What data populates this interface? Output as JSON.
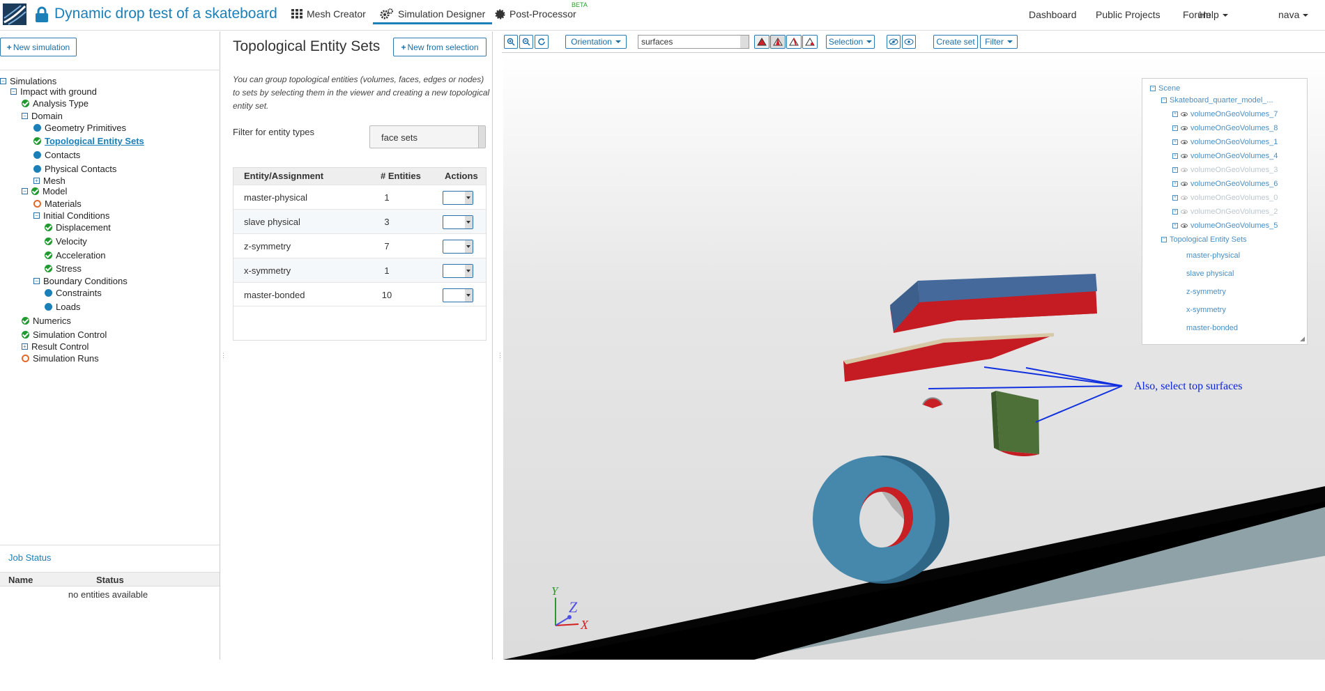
{
  "header": {
    "project_title": "Dynamic drop test of a skateboard",
    "nav": [
      {
        "label": "Mesh Creator",
        "icon": "grid-icon"
      },
      {
        "label": "Simulation Designer",
        "icon": "gears-icon",
        "active": true
      },
      {
        "label": "Post-Processor",
        "icon": "gear-icon"
      }
    ],
    "beta": "BETA",
    "right_nav": [
      "Dashboard",
      "Public Projects",
      "Forum",
      "Help"
    ],
    "user": "nava"
  },
  "left": {
    "new_simulation": "New simulation",
    "tree": {
      "simulations": "Simulations",
      "impact": "Impact with ground",
      "analysis_type": "Analysis Type",
      "domain": "Domain",
      "geometry_primitives": "Geometry Primitives",
      "topological_entity_sets": "Topological Entity Sets",
      "contacts": "Contacts",
      "physical_contacts": "Physical Contacts",
      "mesh": "Mesh",
      "model": "Model",
      "materials": "Materials",
      "initial_conditions": "Initial Conditions",
      "displacement": "Displacement",
      "velocity": "Velocity",
      "acceleration": "Acceleration",
      "stress": "Stress",
      "boundary_conditions": "Boundary Conditions",
      "constraints": "Constraints",
      "loads": "Loads",
      "numerics": "Numerics",
      "simulation_control": "Simulation Control",
      "result_control": "Result Control",
      "simulation_runs": "Simulation Runs"
    },
    "job_status": {
      "title": "Job Status",
      "col_name": "Name",
      "col_status": "Status",
      "empty": "no entities available"
    }
  },
  "middle": {
    "title": "Topological Entity Sets",
    "new_from_selection": "New from selection",
    "description": "You can group topological entities (volumes, faces, edges or nodes) to sets by selecting them in the viewer and creating a new topological entity set.",
    "filter_label": "Filter for entity types",
    "filter_value": "face sets",
    "table": {
      "headers": [
        "Entity/Assignment",
        "# Entities",
        "Actions"
      ],
      "rows": [
        {
          "name": "master-physical",
          "count": "1"
        },
        {
          "name": "slave physical",
          "count": "3"
        },
        {
          "name": "z-symmetry",
          "count": "7"
        },
        {
          "name": "x-symmetry",
          "count": "1"
        },
        {
          "name": "master-bonded",
          "count": "10"
        }
      ]
    }
  },
  "viewer": {
    "toolbar": {
      "orientation": "Orientation",
      "mode_select": "surfaces",
      "selection": "Selection",
      "create_set": "Create set",
      "filter": "Filter"
    },
    "scene": {
      "root": "Scene",
      "model": "Skateboard_quarter_model_...",
      "volumes": [
        {
          "label": "volumeOnGeoVolumes_7",
          "visible": true
        },
        {
          "label": "volumeOnGeoVolumes_8",
          "visible": true
        },
        {
          "label": "volumeOnGeoVolumes_1",
          "visible": true
        },
        {
          "label": "volumeOnGeoVolumes_4",
          "visible": true
        },
        {
          "label": "volumeOnGeoVolumes_3",
          "visible": false
        },
        {
          "label": "volumeOnGeoVolumes_6",
          "visible": true
        },
        {
          "label": "volumeOnGeoVolumes_0",
          "visible": false
        },
        {
          "label": "volumeOnGeoVolumes_2",
          "visible": false
        },
        {
          "label": "volumeOnGeoVolumes_5",
          "visible": true
        }
      ],
      "sets_label": "Topological Entity Sets",
      "sets": [
        "master-physical",
        "slave physical",
        "z-symmetry",
        "x-symmetry",
        "master-bonded"
      ]
    },
    "annotation": "Also,  select top surfaces",
    "axes": {
      "y": "Y",
      "z": "Z",
      "x": "X"
    }
  },
  "colors": {
    "accent": "#1c80b8",
    "check_green": "#1f9a2f",
    "pending_orange": "#e3692a",
    "annotation_blue": "#0a23d8"
  }
}
